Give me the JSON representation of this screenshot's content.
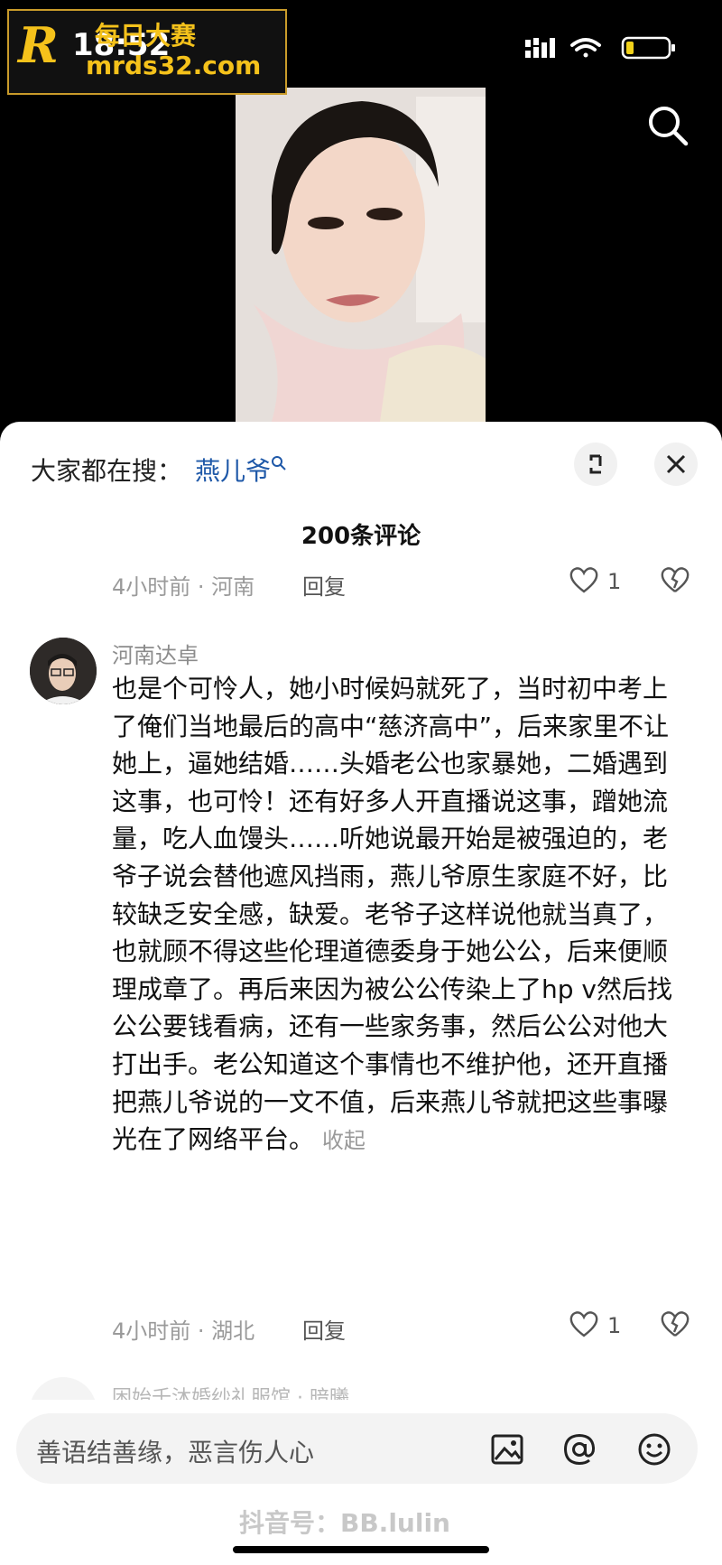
{
  "status_bar": {
    "time": "18:52"
  },
  "watermark_logo": {
    "letter": "R",
    "site_name": "每日大赛",
    "site_url": "mrds32.com"
  },
  "search_bar": {
    "prefix": "大家都在搜：",
    "keyword": "燕儿爷"
  },
  "comments": {
    "count_label": "200条评论",
    "previous": {
      "meta": "4小时前 · 河南",
      "reply_label": "回复",
      "likes": "1"
    },
    "main": {
      "username": "河南达卓",
      "text": "也是个可怜人，她小时候妈就死了，当时初中考上了俺们当地最后的高中“慈济高中”，后来家里不让她上，逼她结婚……头婚老公也家暴她，二婚遇到这事，也可怜！还有好多人开直播说这事，蹭她流量，吃人血馒头……听她说最开始是被强迫的，老爷子说会替他遮风挡雨，燕儿爷原生家庭不好，比较缺乏安全感，缺爱。老爷子这样说他就当真了，也就顾不得这些伦理道德委身于她公公，后来便顺理成章了。再后来因为被公公传染上了hp v然后找公公要钱看病，还有一些家务事，然后公公对他大打出手。老公知道这个事情也不维护他，还开直播把燕儿爷说的一文不值，后来燕儿爷就把这些事曝光在了网络平台。",
      "collapse_label": "收起",
      "meta": "4小时前 · 湖北",
      "reply_label": "回复",
      "likes": "1"
    },
    "next_partial": "困始千沐婚纱礼服馆 · 暗曦"
  },
  "input_bar": {
    "placeholder": "善语结善缘，恶言伤人心"
  },
  "footer_watermark": "抖音号：BB.lulin",
  "icons": [
    "search-icon",
    "expand-icon",
    "close-icon",
    "heart-icon",
    "dislike-icon",
    "image-icon",
    "at-icon",
    "emoji-icon"
  ]
}
